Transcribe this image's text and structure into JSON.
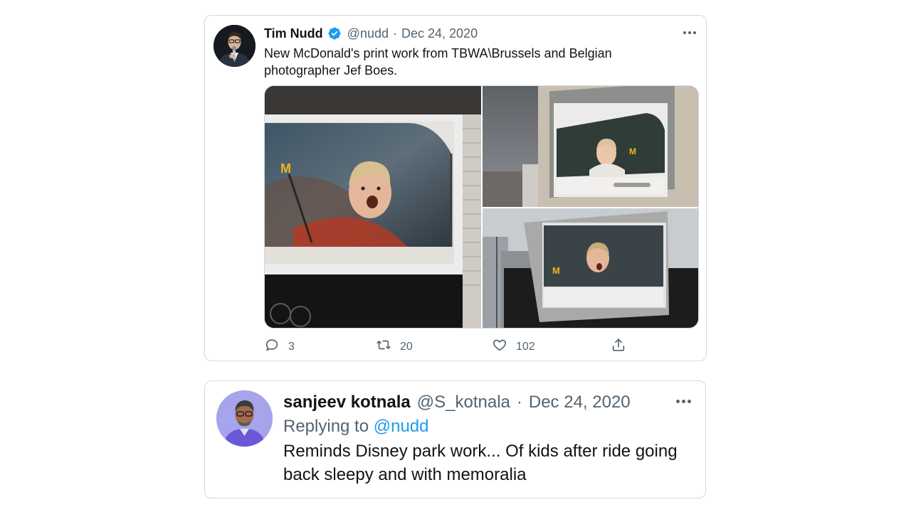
{
  "tweet": {
    "author_name": "Tim Nudd",
    "verified": true,
    "handle": "@nudd",
    "separator": "·",
    "date": "Dec 24, 2020",
    "text": "New McDonald's print work from TBWA\\Brussels and Belgian photographer Jef Boes.",
    "stats": {
      "replies": "3",
      "retweets": "20",
      "likes": "102"
    }
  },
  "reply": {
    "author_name": "sanjeev kotnala",
    "handle": "@S_kotnala",
    "separator": "·",
    "date": "Dec 24, 2020",
    "replying_to_label": "Replying to",
    "replying_to_handle": "@nudd",
    "text": "Reminds Disney park work... Of kids after ride going back sleepy and with memoralia"
  },
  "colors": {
    "accent": "#1d9bf0",
    "text_primary": "#0f1419",
    "text_secondary": "#536471",
    "border": "#cfd9de"
  },
  "icons": {
    "more": "more-horizontal-icon",
    "verified": "verified-badge-icon",
    "reply": "reply-icon",
    "retweet": "retweet-icon",
    "like": "heart-icon",
    "share": "share-icon"
  }
}
